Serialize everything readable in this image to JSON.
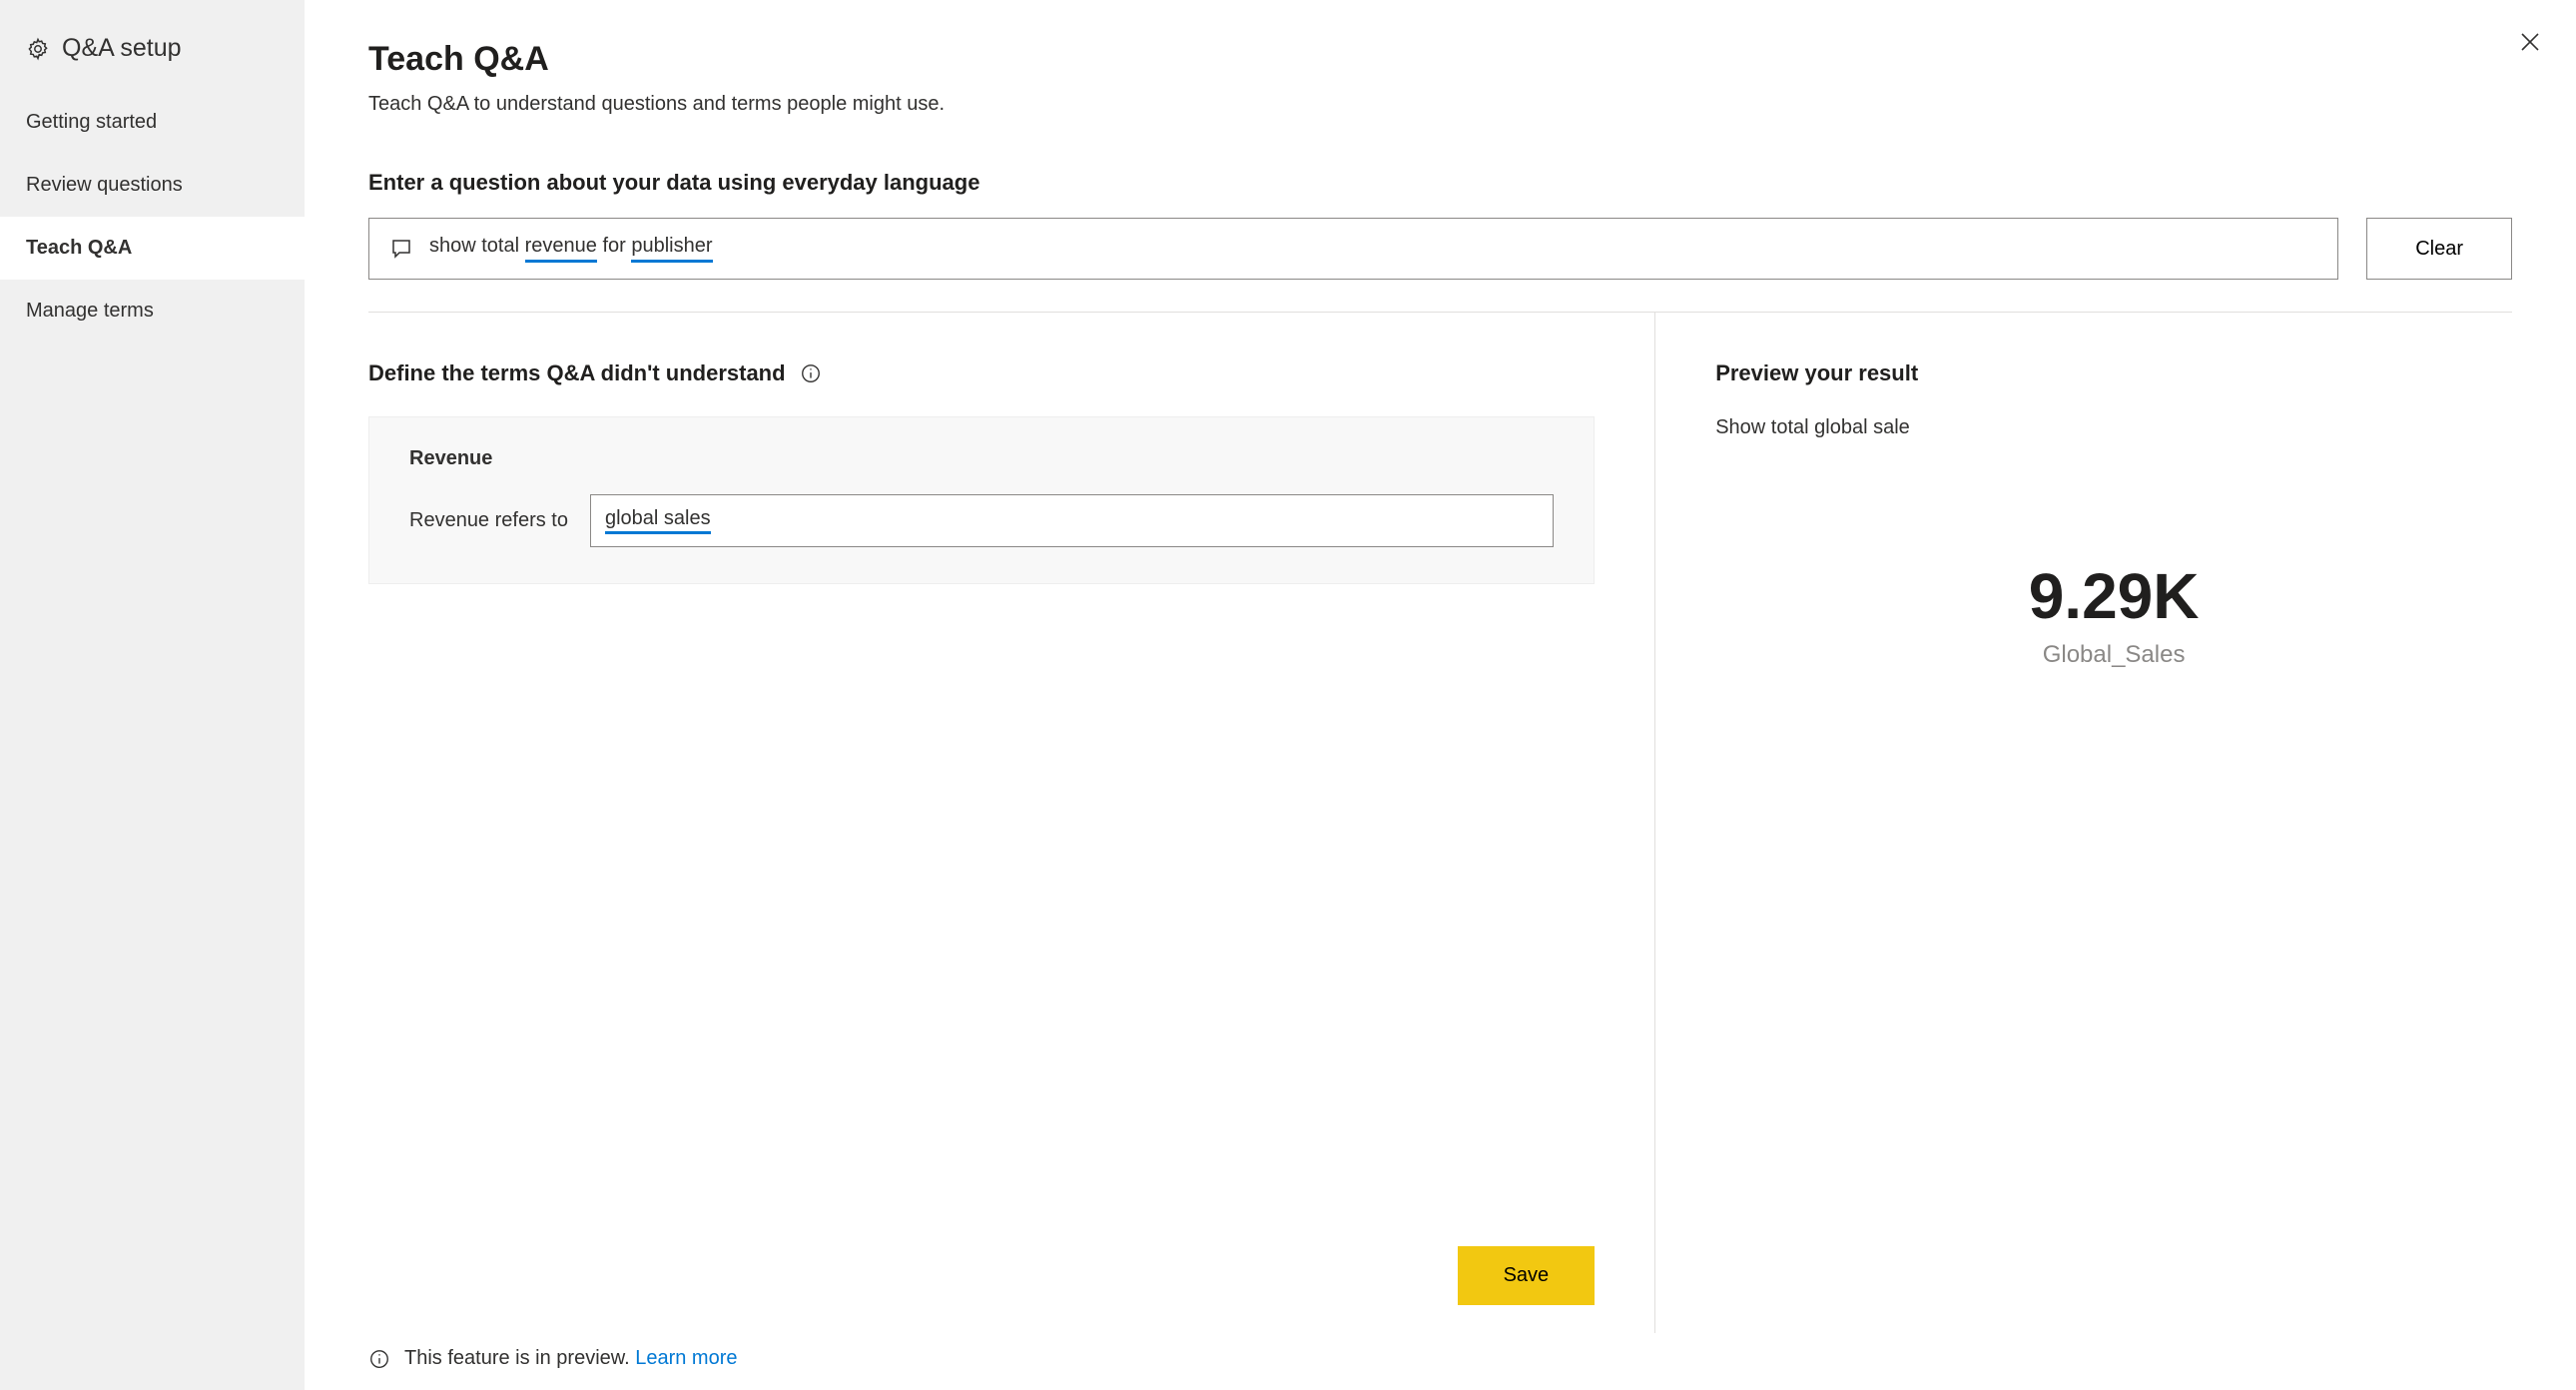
{
  "sidebar": {
    "title": "Q&A setup",
    "items": [
      {
        "label": "Getting started",
        "active": false
      },
      {
        "label": "Review questions",
        "active": false
      },
      {
        "label": "Teach Q&A",
        "active": true
      },
      {
        "label": "Manage terms",
        "active": false
      }
    ]
  },
  "main": {
    "title": "Teach Q&A",
    "subtitle": "Teach Q&A to understand questions and terms people might use.",
    "question_label": "Enter a question about your data using everyday language",
    "question_prefix": "show total ",
    "question_underlined_1": "revenue",
    "question_mid": " for ",
    "question_underlined_2": "publisher",
    "clear_label": "Clear"
  },
  "define": {
    "heading": "Define the terms Q&A didn't understand",
    "term_name": "Revenue",
    "refers_label": "Revenue refers to",
    "term_value": "global sales",
    "save_label": "Save"
  },
  "preview": {
    "heading": "Preview your result",
    "caption": "Show total global sale",
    "value": "9.29K",
    "field": "Global_Sales"
  },
  "footer": {
    "text": "This feature is in preview. ",
    "link": "Learn more"
  }
}
